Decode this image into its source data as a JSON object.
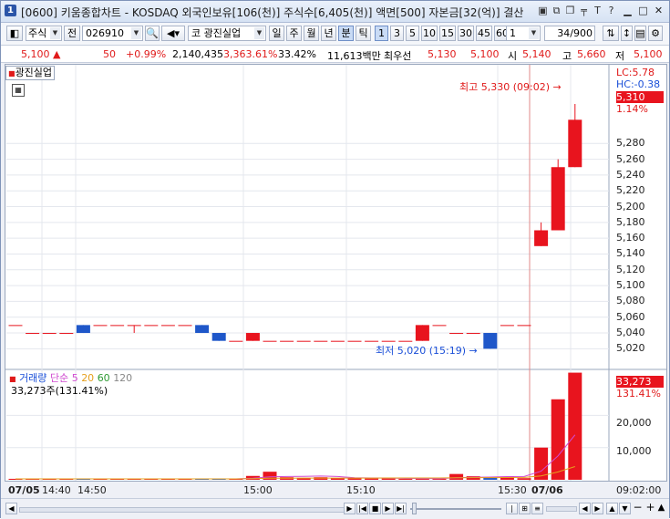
{
  "title": {
    "badge": "1",
    "text": "[0600] 키움종합차트 - KOSDAQ 외국인보유[106(천)] 주식수[6,405(천)] 액면[500] 자본금[32(억)] 결산"
  },
  "toolbar": {
    "type": "주식",
    "code_prefix": "전",
    "code": "026910",
    "market": "코",
    "stock_name": "광진실업",
    "periods": [
      "일",
      "주",
      "월",
      "년",
      "분",
      "틱"
    ],
    "selected_period": "분",
    "intervals": [
      "1",
      "3",
      "5",
      "10",
      "15",
      "30",
      "45",
      "60"
    ],
    "selected_interval": "1",
    "multiplier": "1",
    "count": "34",
    "count_total": "/900"
  },
  "quote": {
    "price": "5,100",
    "price_arrow": "▲",
    "change": "50",
    "change_pct": "+0.99%",
    "volume": "2,140,435",
    "volume_ratio": "3,363.61%",
    "turnover": "33.42%",
    "amount": "11,613백만",
    "best_label": "최우선",
    "best_ask": "5,130",
    "best_bid": "5,100",
    "open_label": "시",
    "open": "5,140",
    "high_label": "고",
    "high": "5,660",
    "low_label": "저",
    "low": "5,100"
  },
  "chart_tag": "광진실업",
  "axis": {
    "lc_label": "LC:5.78",
    "hc_label": "HC:-0.38",
    "current_price": "5,310",
    "current_pct": "1.14%",
    "ticks": [
      "5,280",
      "5,260",
      "5,240",
      "5,220",
      "5,200",
      "5,180",
      "5,160",
      "5,140",
      "5,120",
      "5,100",
      "5,080",
      "5,060",
      "5,040",
      "5,020"
    ],
    "vol_current": "33,273",
    "vol_current_pct": "131.41%",
    "vol_ticks": [
      "20,000",
      "10,000"
    ]
  },
  "annotations": {
    "high": "최고 5,330 (09:02)",
    "low": "최저 5,020 (15:19)"
  },
  "volume_legend": {
    "name": "거래량",
    "ma_label": "단순",
    "ma": [
      "5",
      "20",
      "60",
      "120"
    ],
    "value": "33,273주(131.41%)"
  },
  "xaxis": {
    "labels": [
      "07/05",
      "14:40",
      "14:50",
      "15:00",
      "15:10",
      "15:30",
      "07/06"
    ],
    "time_label": "09:02:00"
  },
  "colors": {
    "up": "#e8141e",
    "down": "#1f57c9",
    "ma5": "#d04bd0",
    "ma20": "#e6a01e",
    "ma60": "#2e9a33",
    "ma120": "#888888"
  },
  "chart_data": {
    "type": "candlestick",
    "candles": [
      {
        "o": 5050,
        "h": 5050,
        "l": 5050,
        "c": 5050
      },
      {
        "o": 5040,
        "h": 5040,
        "l": 5040,
        "c": 5040
      },
      {
        "o": 5040,
        "h": 5040,
        "l": 5040,
        "c": 5040
      },
      {
        "o": 5040,
        "h": 5040,
        "l": 5040,
        "c": 5040
      },
      {
        "o": 5050,
        "h": 5050,
        "l": 5040,
        "c": 5040
      },
      {
        "o": 5050,
        "h": 5050,
        "l": 5050,
        "c": 5050
      },
      {
        "o": 5050,
        "h": 5050,
        "l": 5050,
        "c": 5050
      },
      {
        "o": 5050,
        "h": 5050,
        "l": 5040,
        "c": 5050
      },
      {
        "o": 5050,
        "h": 5050,
        "l": 5050,
        "c": 5050
      },
      {
        "o": 5050,
        "h": 5050,
        "l": 5050,
        "c": 5050
      },
      {
        "o": 5050,
        "h": 5050,
        "l": 5050,
        "c": 5050
      },
      {
        "o": 5050,
        "h": 5050,
        "l": 5040,
        "c": 5040
      },
      {
        "o": 5040,
        "h": 5040,
        "l": 5030,
        "c": 5030
      },
      {
        "o": 5030,
        "h": 5030,
        "l": 5030,
        "c": 5030
      },
      {
        "o": 5030,
        "h": 5040,
        "l": 5030,
        "c": 5040
      },
      {
        "o": 5030,
        "h": 5030,
        "l": 5030,
        "c": 5030
      },
      {
        "o": 5030,
        "h": 5030,
        "l": 5030,
        "c": 5030
      },
      {
        "o": 5030,
        "h": 5030,
        "l": 5030,
        "c": 5030
      },
      {
        "o": 5030,
        "h": 5030,
        "l": 5030,
        "c": 5030
      },
      {
        "o": 5030,
        "h": 5030,
        "l": 5030,
        "c": 5030
      },
      {
        "o": 5030,
        "h": 5030,
        "l": 5030,
        "c": 5030
      },
      {
        "o": 5030,
        "h": 5030,
        "l": 5030,
        "c": 5030
      },
      {
        "o": 5030,
        "h": 5030,
        "l": 5030,
        "c": 5030
      },
      {
        "o": 5030,
        "h": 5030,
        "l": 5030,
        "c": 5030
      },
      {
        "o": 5030,
        "h": 5050,
        "l": 5030,
        "c": 5050
      },
      {
        "o": 5050,
        "h": 5050,
        "l": 5050,
        "c": 5050
      },
      {
        "o": 5040,
        "h": 5040,
        "l": 5040,
        "c": 5040
      },
      {
        "o": 5040,
        "h": 5040,
        "l": 5040,
        "c": 5040
      },
      {
        "o": 5040,
        "h": 5040,
        "l": 5020,
        "c": 5020
      },
      {
        "o": 5050,
        "h": 5050,
        "l": 5050,
        "c": 5050
      },
      {
        "o": 5050,
        "h": 5050,
        "l": 5050,
        "c": 5050
      },
      {
        "o": 5150,
        "h": 5180,
        "l": 5150,
        "c": 5170
      },
      {
        "o": 5170,
        "h": 5260,
        "l": 5170,
        "c": 5250
      },
      {
        "o": 5250,
        "h": 5330,
        "l": 5250,
        "c": 5310
      }
    ],
    "volume": [
      300,
      300,
      300,
      300,
      300,
      300,
      300,
      300,
      300,
      300,
      300,
      300,
      300,
      300,
      1200,
      2500,
      800,
      600,
      800,
      500,
      500,
      400,
      400,
      300,
      400,
      300,
      1800,
      1100,
      700,
      1000,
      500,
      10000,
      25000,
      33273
    ],
    "ylim": [
      5010,
      5345
    ],
    "vol_max": 34000
  }
}
